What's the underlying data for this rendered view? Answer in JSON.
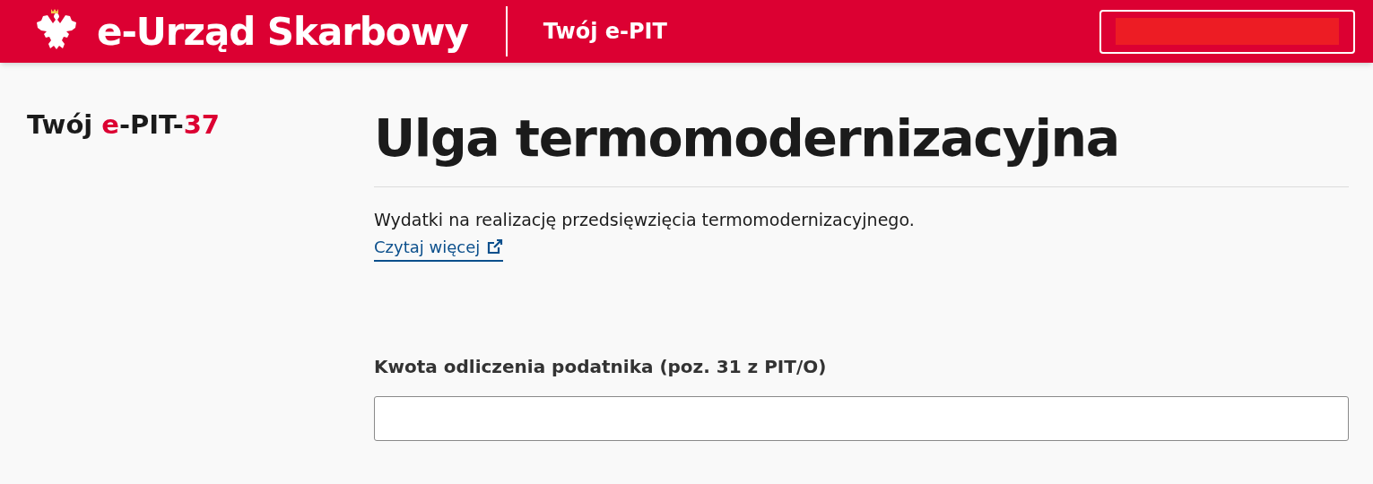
{
  "header": {
    "title": "e-Urząd Skarbowy",
    "subtitle": "Twój e-PIT",
    "account_button": {
      "kind": "redacted"
    }
  },
  "sidebar": {
    "title_parts": [
      {
        "text": "Twój ",
        "accent": false
      },
      {
        "text": "e",
        "accent": true
      },
      {
        "text": "-PIT-",
        "accent": false
      },
      {
        "text": "37",
        "accent": true
      }
    ]
  },
  "main": {
    "heading": "Ulga termomodernizacyjna",
    "description": "Wydatki na realizację przedsięwzięcia termomodernizacyjnego.",
    "link": "Czytaj więcej",
    "field": {
      "label": "Kwota odliczenia podatnika (poz. 31 z PIT/O)"
    }
  }
}
